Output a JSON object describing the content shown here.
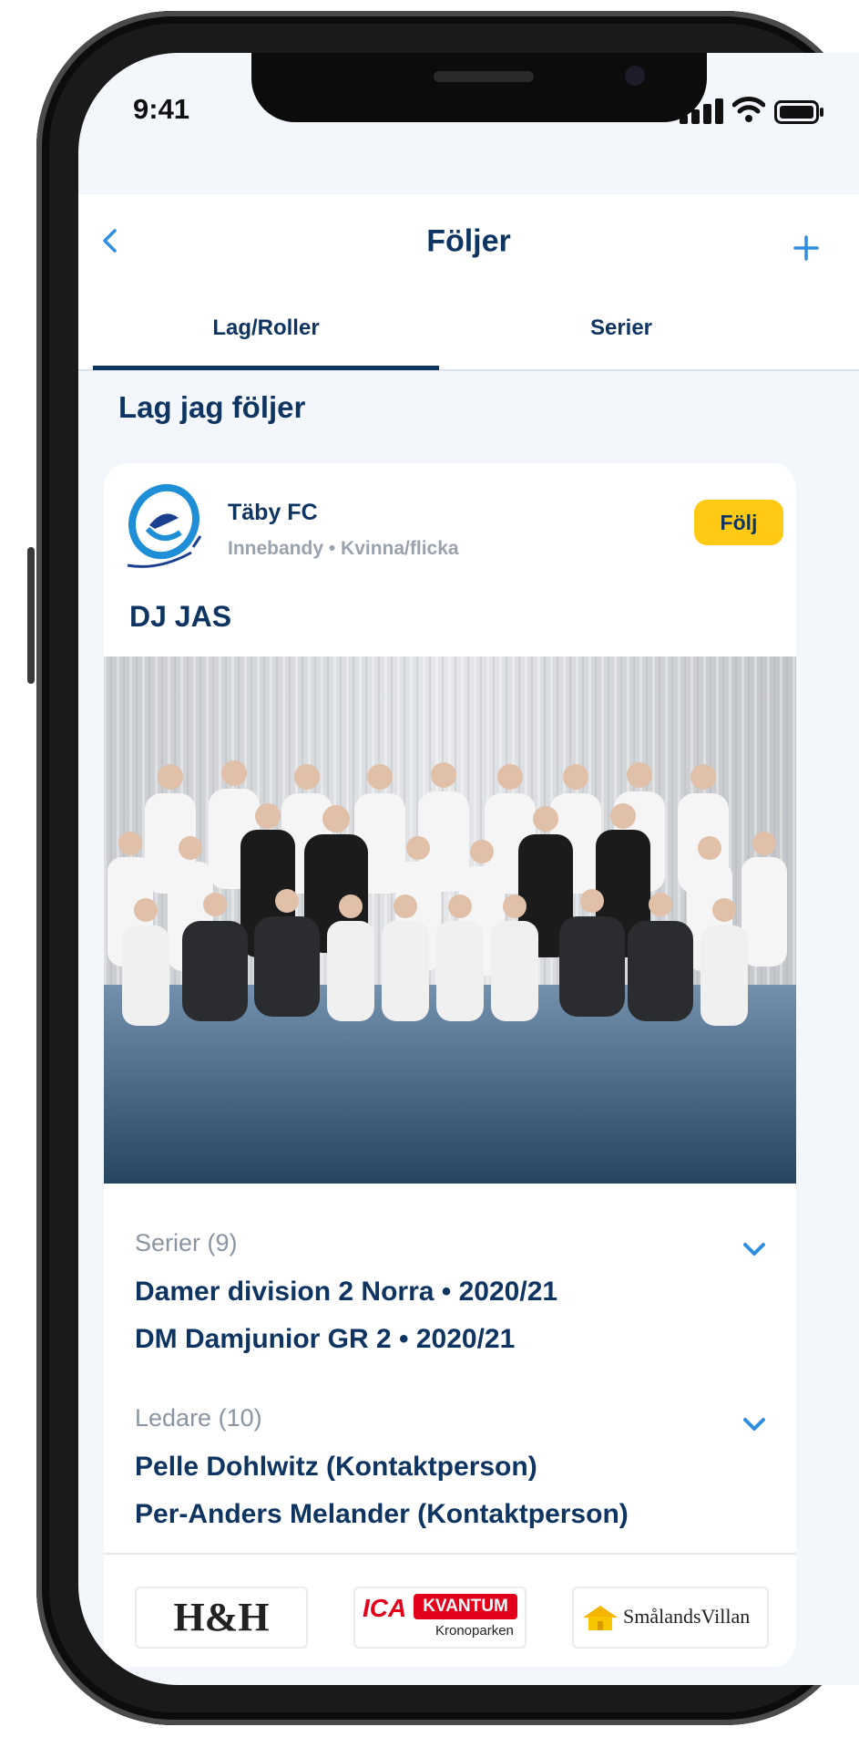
{
  "status_bar": {
    "time": "9:41"
  },
  "navbar": {
    "title": "Följer",
    "back_icon": "chevron-left-icon",
    "add_icon": "plus-icon"
  },
  "tabs": [
    {
      "label": "Lag/Roller",
      "active": true
    },
    {
      "label": "Serier",
      "active": false
    }
  ],
  "section": {
    "title": "Lag jag följer"
  },
  "team_card": {
    "club_name": "Täby FC",
    "club_meta": "Innebandy • Kvinna/flicka",
    "follow_label": "Följ",
    "team_name": "DJ JAS",
    "series": {
      "label": "Serier (9)",
      "items": [
        "Damer division 2 Norra • 2020/21",
        "DM Damjunior GR 2 • 2020/21"
      ]
    },
    "leaders": {
      "label": "Ledare (10)",
      "items": [
        "Pelle Dohlwitz (Kontaktperson)",
        "Per-Anders Melander (Kontaktperson)"
      ]
    },
    "sponsors": {
      "hh": "H&H",
      "ica": "ICA",
      "kvantum": "KVANTUM",
      "kronoparken": "Kronoparken",
      "smalandsvillan": "SmålandsVillan"
    }
  },
  "colors": {
    "primary": "#0e3561",
    "accent_yellow": "#ffc914",
    "muted_text": "#8b95a1",
    "screen_bg": "#f3f6fa",
    "ica_red": "#e2001a"
  }
}
